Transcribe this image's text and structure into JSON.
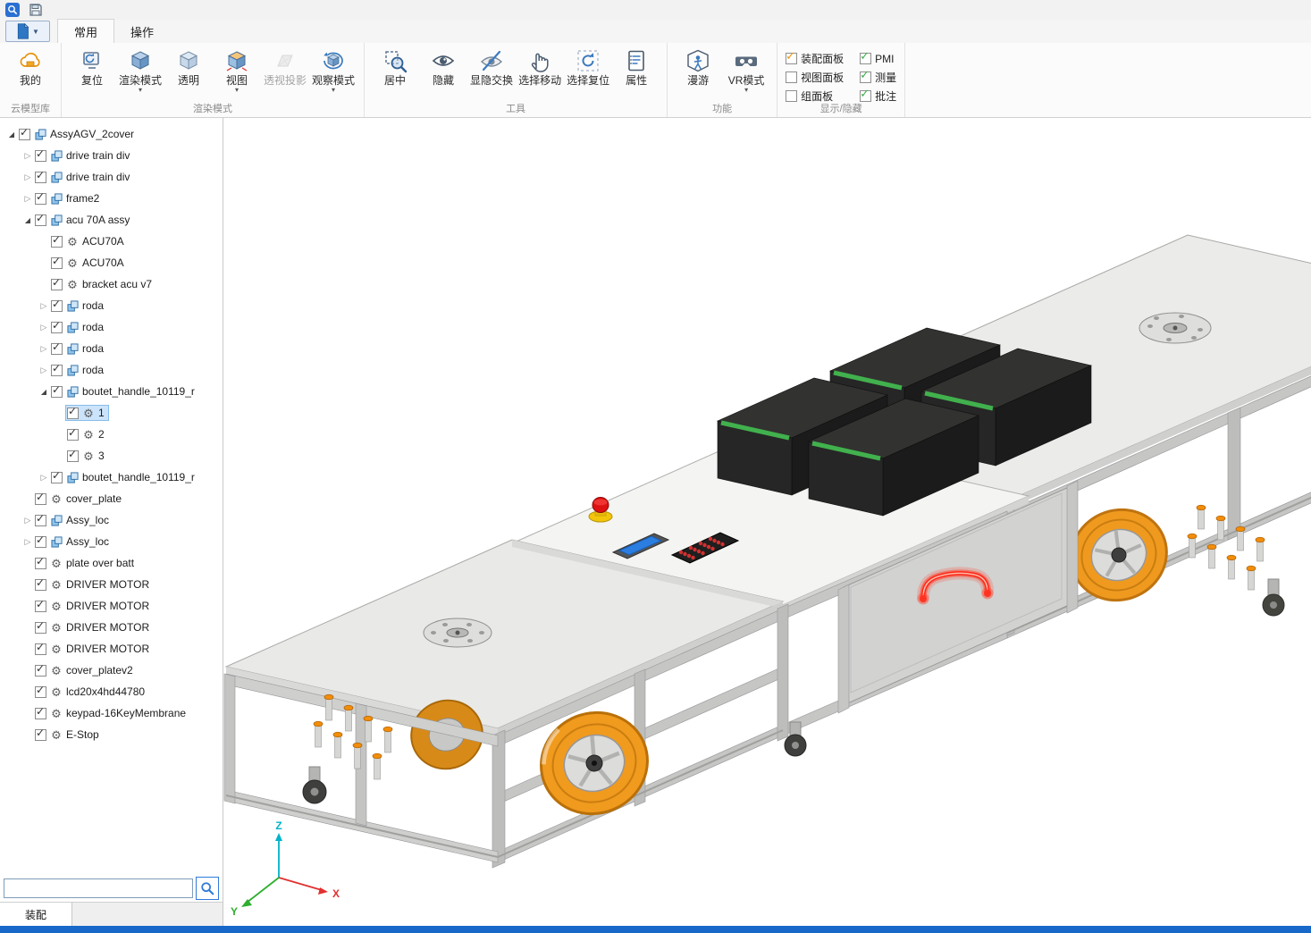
{
  "titlebar": {
    "app_icon": "app-logo-icon",
    "save_icon": "save-icon"
  },
  "ribbon": {
    "tabs": [
      {
        "label": "常用",
        "active": true
      },
      {
        "label": "操作",
        "active": false
      }
    ],
    "groups": [
      {
        "name": "cloud-library",
        "label": "云模型库",
        "items": [
          {
            "label": "我的",
            "icon": "cloud-icon"
          }
        ]
      },
      {
        "name": "render-mode",
        "label": "渲染模式",
        "items": [
          {
            "label": "复位",
            "icon": "reset-icon"
          },
          {
            "label": "渲染模式",
            "icon": "render-cube-icon",
            "dropdown": true
          },
          {
            "label": "透明",
            "icon": "transparent-cube-icon"
          },
          {
            "label": "视图",
            "icon": "view-cube-icon",
            "dropdown": true
          },
          {
            "label": "透视投影",
            "icon": "perspective-icon",
            "disabled": true
          },
          {
            "label": "观察模式",
            "icon": "observe-icon",
            "dropdown": true
          }
        ]
      },
      {
        "name": "tools",
        "label": "工具",
        "items": [
          {
            "label": "居中",
            "icon": "center-icon"
          },
          {
            "label": "隐藏",
            "icon": "hide-eye-icon"
          },
          {
            "label": "显隐交换",
            "icon": "toggle-visibility-icon"
          },
          {
            "label": "选择移动",
            "icon": "select-move-icon"
          },
          {
            "label": "选择复位",
            "icon": "select-reset-icon"
          },
          {
            "label": "属性",
            "icon": "properties-icon"
          }
        ]
      },
      {
        "name": "functions",
        "label": "功能",
        "items": [
          {
            "label": "漫游",
            "icon": "walkthrough-icon"
          },
          {
            "label": "VR模式",
            "icon": "vr-icon",
            "dropdown": true
          }
        ]
      },
      {
        "name": "show-hide",
        "label": "显示/隐藏",
        "checkboxes": [
          {
            "label": "装配面板",
            "checked": true,
            "check_color": "#e8930c"
          },
          {
            "label": "视图面板",
            "checked": false
          },
          {
            "label": "组面板",
            "checked": false
          },
          {
            "label": "PMI",
            "checked": true,
            "check_color": "#3fae49"
          },
          {
            "label": "测量",
            "checked": true,
            "check_color": "#3fae49"
          },
          {
            "label": "批注",
            "checked": true,
            "check_color": "#3fae49"
          }
        ]
      }
    ]
  },
  "tree": {
    "items": [
      {
        "label": "AssyAGV_2cover",
        "level": 0,
        "expand": "open",
        "icon": "assembly",
        "checked": true
      },
      {
        "label": "drive train div",
        "level": 1,
        "expand": "closed",
        "icon": "assembly",
        "checked": true
      },
      {
        "label": "drive train div",
        "level": 1,
        "expand": "closed",
        "icon": "assembly",
        "checked": true
      },
      {
        "label": "frame2",
        "level": 1,
        "expand": "closed",
        "icon": "assembly",
        "checked": true
      },
      {
        "label": "acu 70A assy",
        "level": 1,
        "expand": "open",
        "icon": "assembly",
        "checked": true
      },
      {
        "label": "ACU70A",
        "level": 2,
        "expand": "none",
        "icon": "part",
        "checked": true
      },
      {
        "label": "ACU70A",
        "level": 2,
        "expand": "none",
        "icon": "part",
        "checked": true
      },
      {
        "label": "bracket acu v7",
        "level": 2,
        "expand": "none",
        "icon": "part",
        "checked": true
      },
      {
        "label": "roda",
        "level": 2,
        "expand": "closed",
        "icon": "assembly",
        "checked": true
      },
      {
        "label": "roda",
        "level": 2,
        "expand": "closed",
        "icon": "assembly",
        "checked": true
      },
      {
        "label": "roda",
        "level": 2,
        "expand": "closed",
        "icon": "assembly",
        "checked": true
      },
      {
        "label": "roda",
        "level": 2,
        "expand": "closed",
        "icon": "assembly",
        "checked": true
      },
      {
        "label": "boutet_handle_10119_r",
        "level": 2,
        "expand": "open",
        "icon": "assembly",
        "checked": true
      },
      {
        "label": "1",
        "level": 3,
        "expand": "none",
        "icon": "part",
        "checked": true,
        "selected": true
      },
      {
        "label": "2",
        "level": 3,
        "expand": "none",
        "icon": "part",
        "checked": true
      },
      {
        "label": "3",
        "level": 3,
        "expand": "none",
        "icon": "part",
        "checked": true
      },
      {
        "label": "boutet_handle_10119_r",
        "level": 2,
        "expand": "closed",
        "icon": "assembly",
        "checked": true
      },
      {
        "label": "cover_plate",
        "level": 1,
        "expand": "none",
        "icon": "part",
        "checked": true
      },
      {
        "label": "Assy_loc",
        "level": 1,
        "expand": "closed",
        "icon": "assembly",
        "checked": true
      },
      {
        "label": "Assy_loc",
        "level": 1,
        "expand": "closed",
        "icon": "assembly",
        "checked": true
      },
      {
        "label": "plate over batt",
        "level": 1,
        "expand": "none",
        "icon": "part",
        "checked": true
      },
      {
        "label": "DRIVER MOTOR",
        "level": 1,
        "expand": "none",
        "icon": "part",
        "checked": true
      },
      {
        "label": "DRIVER MOTOR",
        "level": 1,
        "expand": "none",
        "icon": "part",
        "checked": true
      },
      {
        "label": "DRIVER MOTOR",
        "level": 1,
        "expand": "none",
        "icon": "part",
        "checked": true
      },
      {
        "label": "DRIVER MOTOR",
        "level": 1,
        "expand": "none",
        "icon": "part",
        "checked": true
      },
      {
        "label": "cover_platev2",
        "level": 1,
        "expand": "none",
        "icon": "part",
        "checked": true
      },
      {
        "label": "lcd20x4hd44780",
        "level": 1,
        "expand": "none",
        "icon": "part",
        "checked": true
      },
      {
        "label": "keypad-16KeyMembrane",
        "level": 1,
        "expand": "none",
        "icon": "part",
        "checked": true
      },
      {
        "label": "E-Stop",
        "level": 1,
        "expand": "none",
        "icon": "part",
        "checked": true
      }
    ]
  },
  "search": {
    "value": ""
  },
  "panel": {
    "bottom_tab": "装配"
  },
  "viewport": {
    "background": "#ffffff",
    "axes": {
      "x": "X",
      "y": "Y",
      "z": "Z"
    },
    "axis_colors": {
      "x": "#e23030",
      "y": "#2eaf2e",
      "z": "#00b3c8"
    },
    "highlight_color": "#ff2617",
    "wheel_color": "#f09a1e"
  }
}
